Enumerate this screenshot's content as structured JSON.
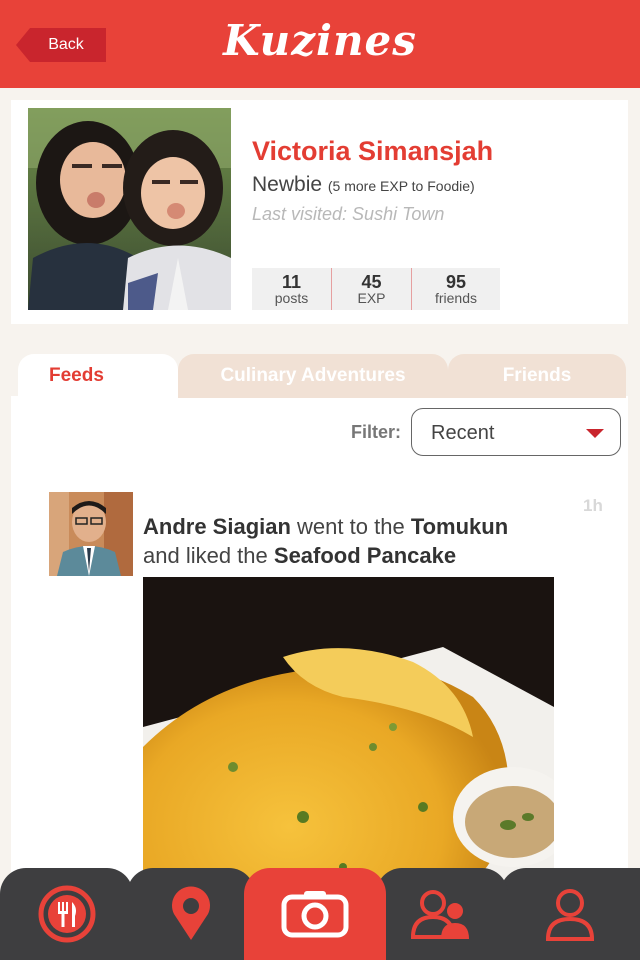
{
  "header": {
    "back_label": "Back",
    "logo": "Kuzines"
  },
  "profile": {
    "name": "Victoria Simansjah",
    "level": "Newbie",
    "level_detail": "(5 more EXP to Foodie)",
    "last_visited": "Last visited: Sushi Town",
    "stats": [
      {
        "value": "11",
        "label": "posts"
      },
      {
        "value": "45",
        "label": "EXP"
      },
      {
        "value": "95",
        "label": "friends"
      }
    ]
  },
  "tabs": [
    {
      "label": "Feeds",
      "active": true
    },
    {
      "label": "Culinary Adventures",
      "active": false
    },
    {
      "label": "Friends",
      "active": false
    }
  ],
  "filter": {
    "label": "Filter:",
    "value": "Recent"
  },
  "feed": {
    "time": "1h",
    "user": "Andre Siagian",
    "verb1": "went to the",
    "place": "Tomukun",
    "verb2": "and liked the",
    "dish": "Seafood Pancake"
  },
  "nav": {
    "items": [
      "restaurants-icon",
      "location-pin-icon",
      "camera-icon",
      "friends-icon",
      "profile-icon"
    ]
  },
  "colors": {
    "brand_red": "#e84239",
    "dark_nav": "#3e3e40",
    "tab_inactive": "#f1e1d5"
  }
}
